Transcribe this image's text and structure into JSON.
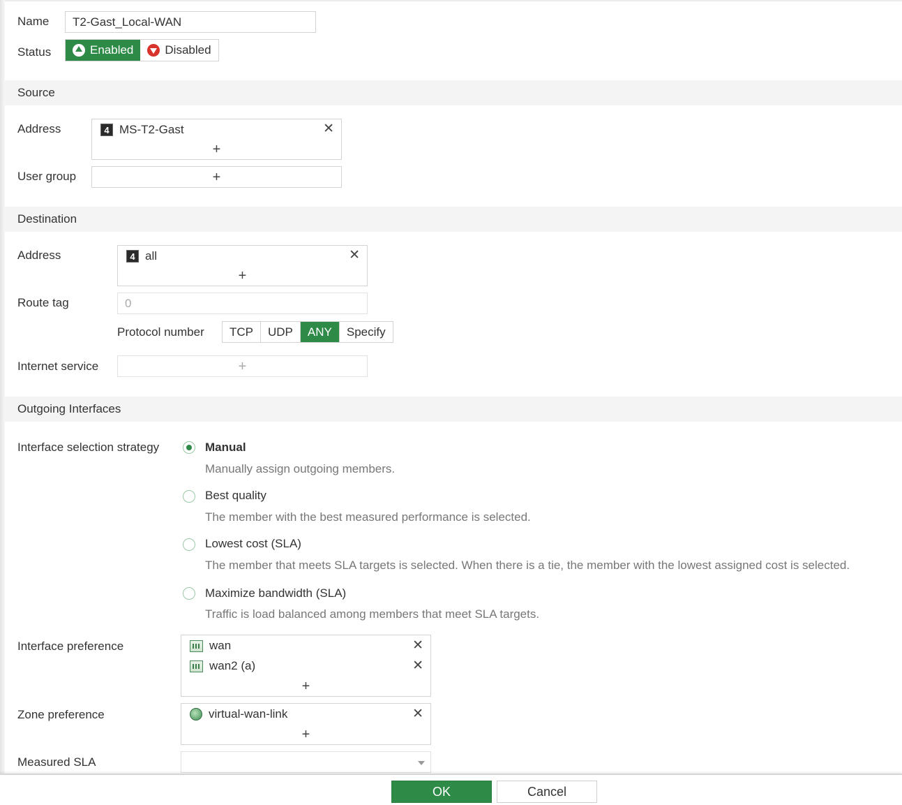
{
  "form": {
    "name_label": "Name",
    "name_value": "T2-Gast_Local-WAN",
    "status_label": "Status",
    "status_enabled": "Enabled",
    "status_disabled": "Disabled"
  },
  "source": {
    "header": "Source",
    "address_label": "Address",
    "address_entries": [
      "MS-T2-Gast"
    ],
    "address_icon_glyph": "4",
    "user_group_label": "User group"
  },
  "destination": {
    "header": "Destination",
    "address_label": "Address",
    "address_entries": [
      "all"
    ],
    "address_icon_glyph": "4",
    "route_tag_label": "Route tag",
    "route_tag_placeholder": "0",
    "protocol_label": "Protocol number",
    "protocol_options": [
      "TCP",
      "UDP",
      "ANY",
      "Specify"
    ],
    "protocol_selected": "ANY",
    "internet_service_label": "Internet service"
  },
  "outgoing": {
    "header": "Outgoing Interfaces",
    "strategy_label": "Interface selection strategy",
    "strategies": [
      {
        "title": "Manual",
        "desc": "Manually assign outgoing members.",
        "checked": true
      },
      {
        "title": "Best quality",
        "desc": "The member with the best measured performance is selected.",
        "checked": false
      },
      {
        "title": "Lowest cost (SLA)",
        "desc": "The member that meets SLA targets is selected. When there is a tie, the member with the lowest assigned cost is selected.",
        "checked": false
      },
      {
        "title": "Maximize bandwidth (SLA)",
        "desc": "Traffic is load balanced among members that meet SLA targets.",
        "checked": false
      }
    ],
    "interface_pref_label": "Interface preference",
    "interface_entries": [
      "wan",
      "wan2 (a)"
    ],
    "zone_pref_label": "Zone preference",
    "zone_entries": [
      "virtual-wan-link"
    ],
    "measured_sla_label": "Measured SLA"
  },
  "footer": {
    "ok_label": "OK",
    "cancel_label": "Cancel"
  },
  "glyphs": {
    "remove": "✕",
    "add": "+"
  },
  "colors": {
    "accent_green": "#2e8a47",
    "disabled_red": "#d9342b",
    "section_bg": "#f3f4f3"
  }
}
